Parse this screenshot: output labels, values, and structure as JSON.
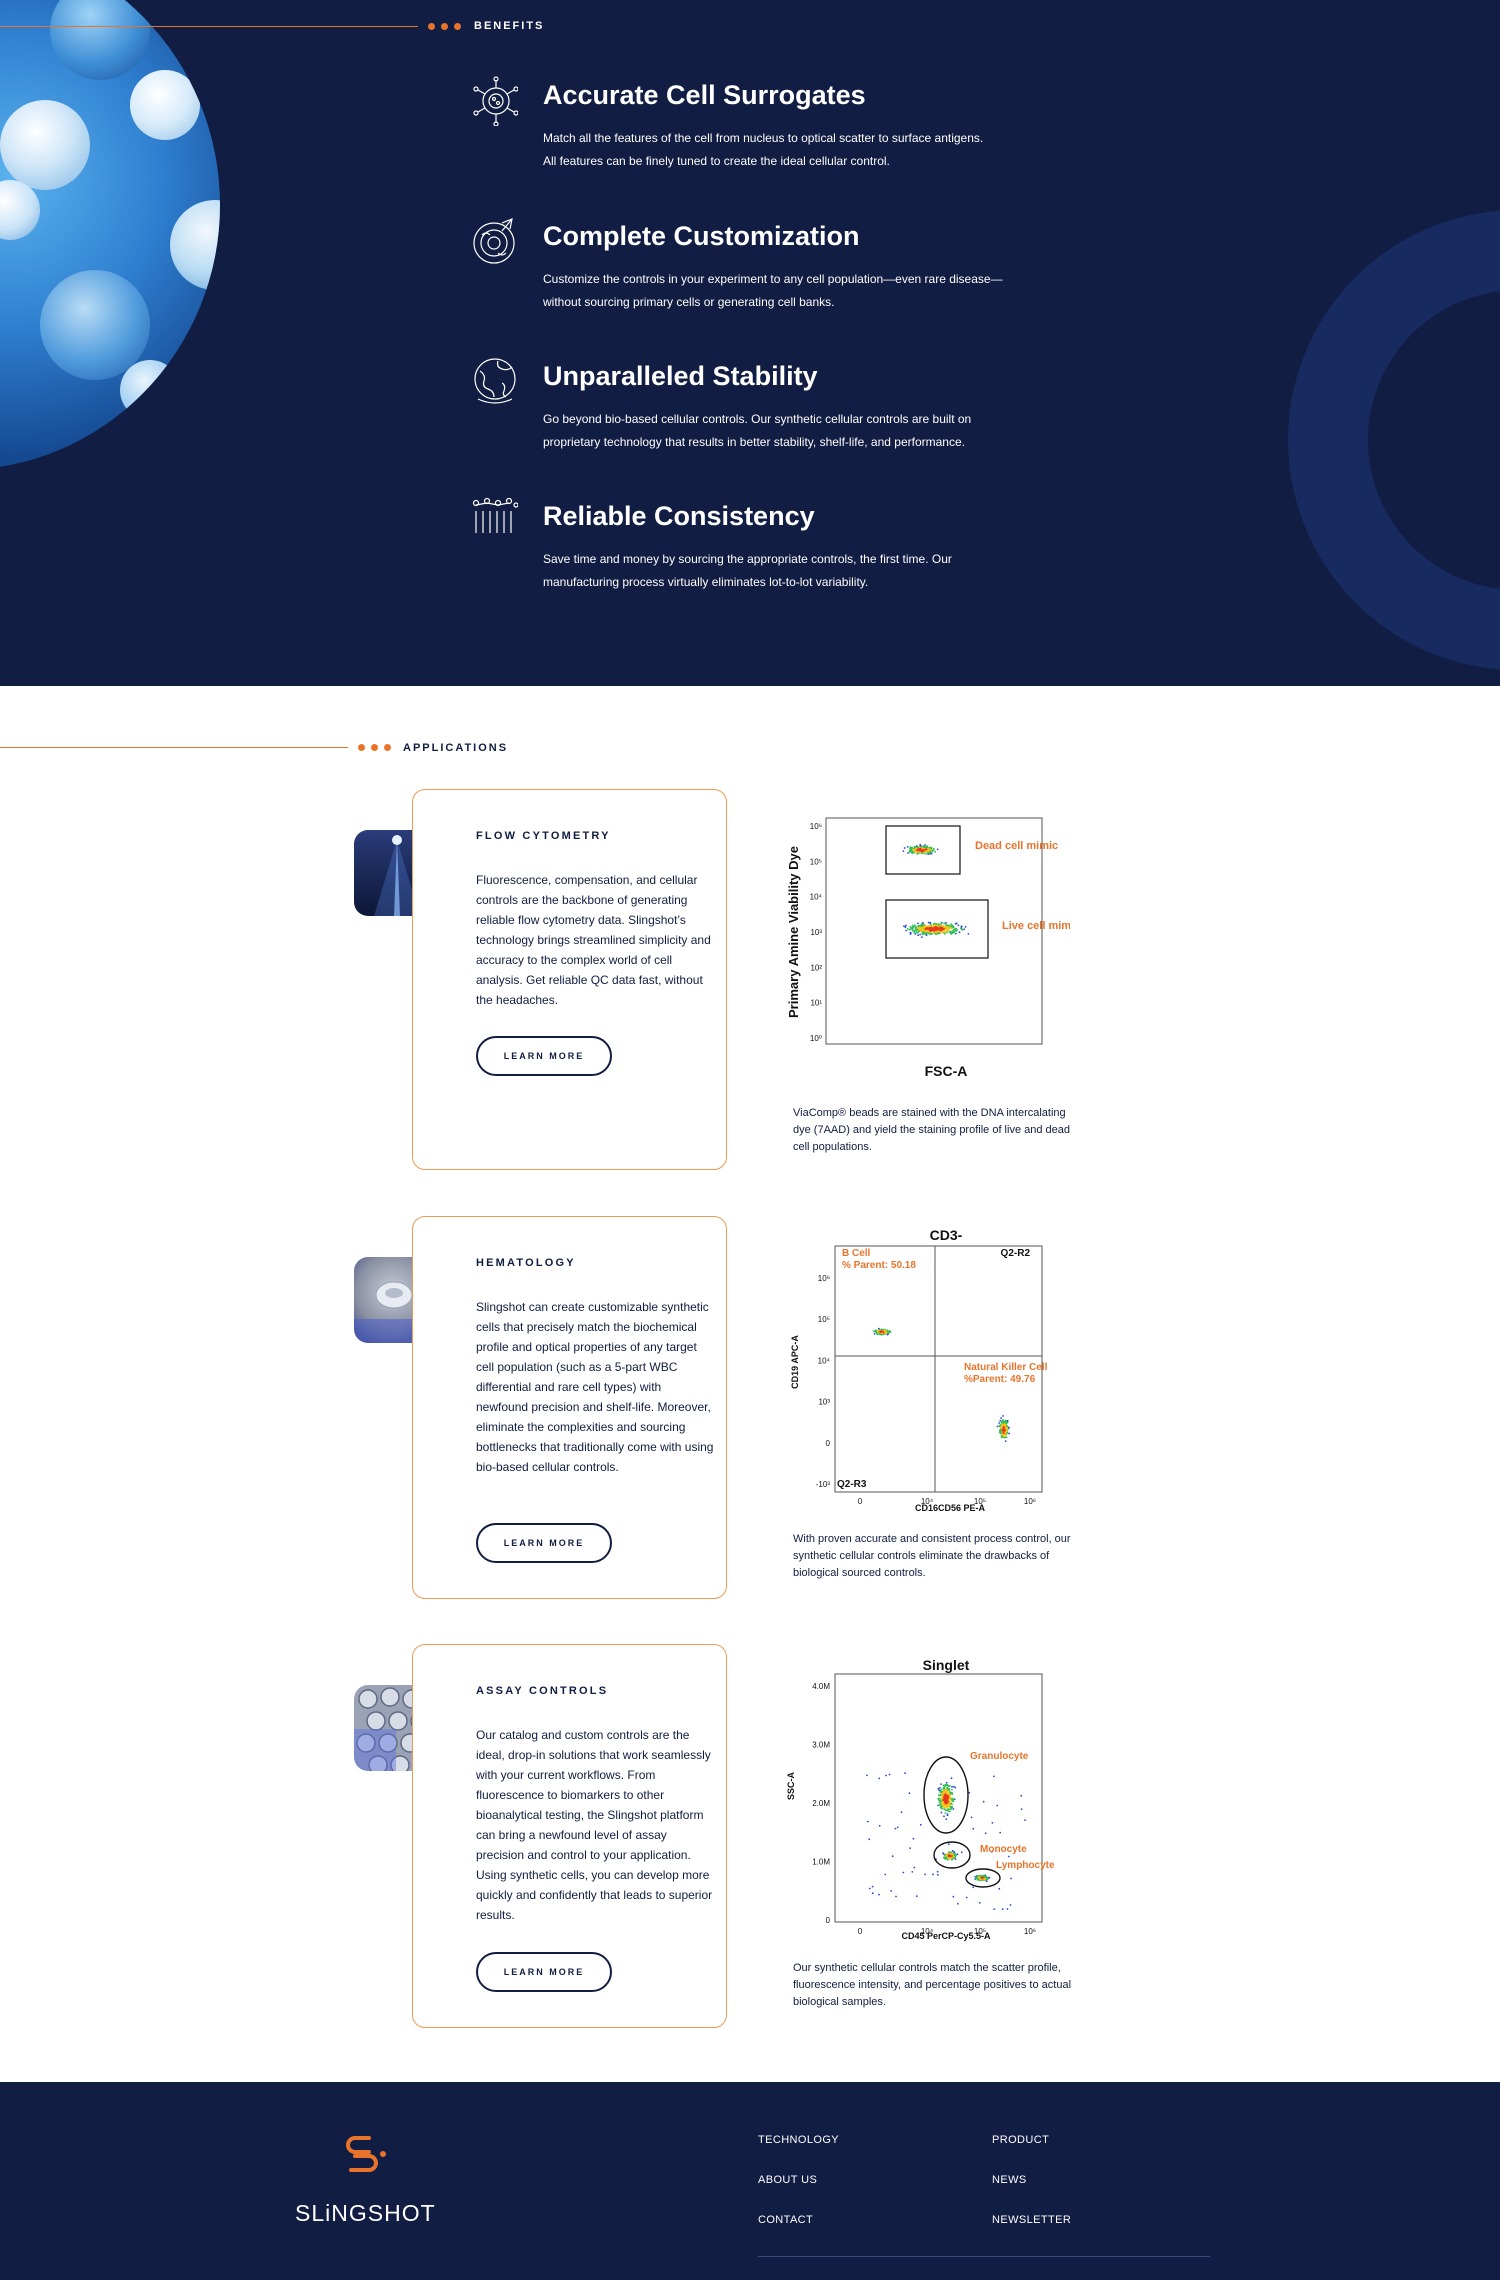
{
  "benefits": {
    "section_label": "BENEFITS",
    "items": [
      {
        "icon": "cell-nucleus-icon",
        "title": "Accurate Cell Surrogates",
        "desc_line1": "Match all the features of the cell from nucleus to optical scatter to surface antigens.",
        "desc_line2": "All features can be finely tuned to create the ideal cellular control."
      },
      {
        "icon": "custom-cell-icon",
        "title": "Complete Customization",
        "desc_line1": "Customize the controls in your experiment to any cell population—even rare disease—",
        "desc_line2": "without sourcing primary cells or generating cell banks."
      },
      {
        "icon": "stability-globe-icon",
        "title": "Unparalleled Stability",
        "desc_line1": "Go beyond bio-based cellular controls. Our synthetic cellular controls are built on",
        "desc_line2": "proprietary technology that results in better stability, shelf-life, and performance."
      },
      {
        "icon": "consistency-bars-icon",
        "title": "Reliable Consistency",
        "desc_line1": "Save time and money by sourcing the appropriate controls, the first time. Our",
        "desc_line2": "manufacturing process virtually eliminates lot-to-lot variability."
      }
    ]
  },
  "applications": {
    "section_label": "APPLICATIONS",
    "cards": [
      {
        "title": "FLOW CYTOMETRY",
        "description": "Fluorescence, compensation, and cellular controls are the backbone of generating reliable flow cytometry data. Slingshot’s technology brings streamlined simplicity and accuracy to the complex world of cell analysis. Get reliable QC data fast, without the headaches.",
        "button": "LEARN MORE",
        "caption": "ViaComp® beads are stained with the DNA intercalating dye (7AAD) and yield the staining profile of live and dead cell populations."
      },
      {
        "title": "HEMATOLOGY",
        "description": "Slingshot can create customizable synthetic cells that precisely match the biochemical profile and optical properties of any target cell population (such as a 5-part WBC differential and rare cell types) with newfound precision and shelf-life. Moreover, eliminate the complexities and sourcing bottlenecks that traditionally come with using bio-based cellular controls.",
        "button": "LEARN MORE",
        "caption": "With proven accurate and consistent process control, our synthetic cellular controls eliminate the drawbacks of biological sourced controls."
      },
      {
        "title": "ASSAY CONTROLS",
        "description": "Our catalog and custom controls are the ideal, drop-in solutions that work seamlessly with your current workflows. From fluorescence to biomarkers to other bioanalytical testing, the Slingshot platform can bring a newfound level of assay precision and control to your application. Using synthetic cells, you can develop more quickly and confidently that leads to superior results.",
        "button": "LEARN MORE",
        "caption": "Our synthetic cellular controls match the scatter profile, fluorescence intensity, and percentage positives to actual biological samples."
      }
    ]
  },
  "chart_data": [
    {
      "type": "scatter",
      "title": "",
      "xlabel": "FSC-A",
      "ylabel": "Primary Amine Viability Dye",
      "yticks": [
        "10⁶",
        "10⁵",
        "10⁴",
        "10³",
        "10²",
        "10¹",
        "10⁰"
      ],
      "gates": [
        {
          "label": "Dead cell mimic"
        },
        {
          "label": "Live cell mimic"
        }
      ]
    },
    {
      "type": "scatter",
      "title": "CD3-",
      "xlabel": "CD16CD56 PE-A",
      "ylabel": "CD19 APC-A",
      "xticks": [
        "0",
        "10⁴",
        "10⁵",
        "10⁶"
      ],
      "yticks": [
        "10⁶",
        "10⁵",
        "10⁴",
        "10³",
        "0",
        "-10³"
      ],
      "quadrants": [
        {
          "name": "B Cell",
          "stat": "% Parent: 50.18"
        },
        {
          "name": "Q2-R2"
        },
        {
          "name": "Natural Killer Cell",
          "stat": "%Parent: 49.76"
        },
        {
          "name": "Q2-R3"
        }
      ]
    },
    {
      "type": "scatter",
      "title": "Singlet",
      "xlabel": "CD45 PerCP-Cy5.5-A",
      "ylabel": "SSC-A",
      "xticks": [
        "0",
        "10⁴",
        "10⁵",
        "10⁶"
      ],
      "yticks": [
        "4.0M",
        "3.0M",
        "2.0M",
        "1.0M",
        "0"
      ],
      "populations": [
        "Granulocyte",
        "Monocyte",
        "Lymphocyte"
      ]
    }
  ],
  "footer": {
    "brand": "SLiNGSHOT",
    "links": [
      "TECHNOLOGY",
      "PRODUCT",
      "ABOUT US",
      "NEWS",
      "CONTACT",
      "NEWSLETTER"
    ]
  },
  "colors": {
    "navy": "#111d42",
    "orange": "#e8742c"
  }
}
